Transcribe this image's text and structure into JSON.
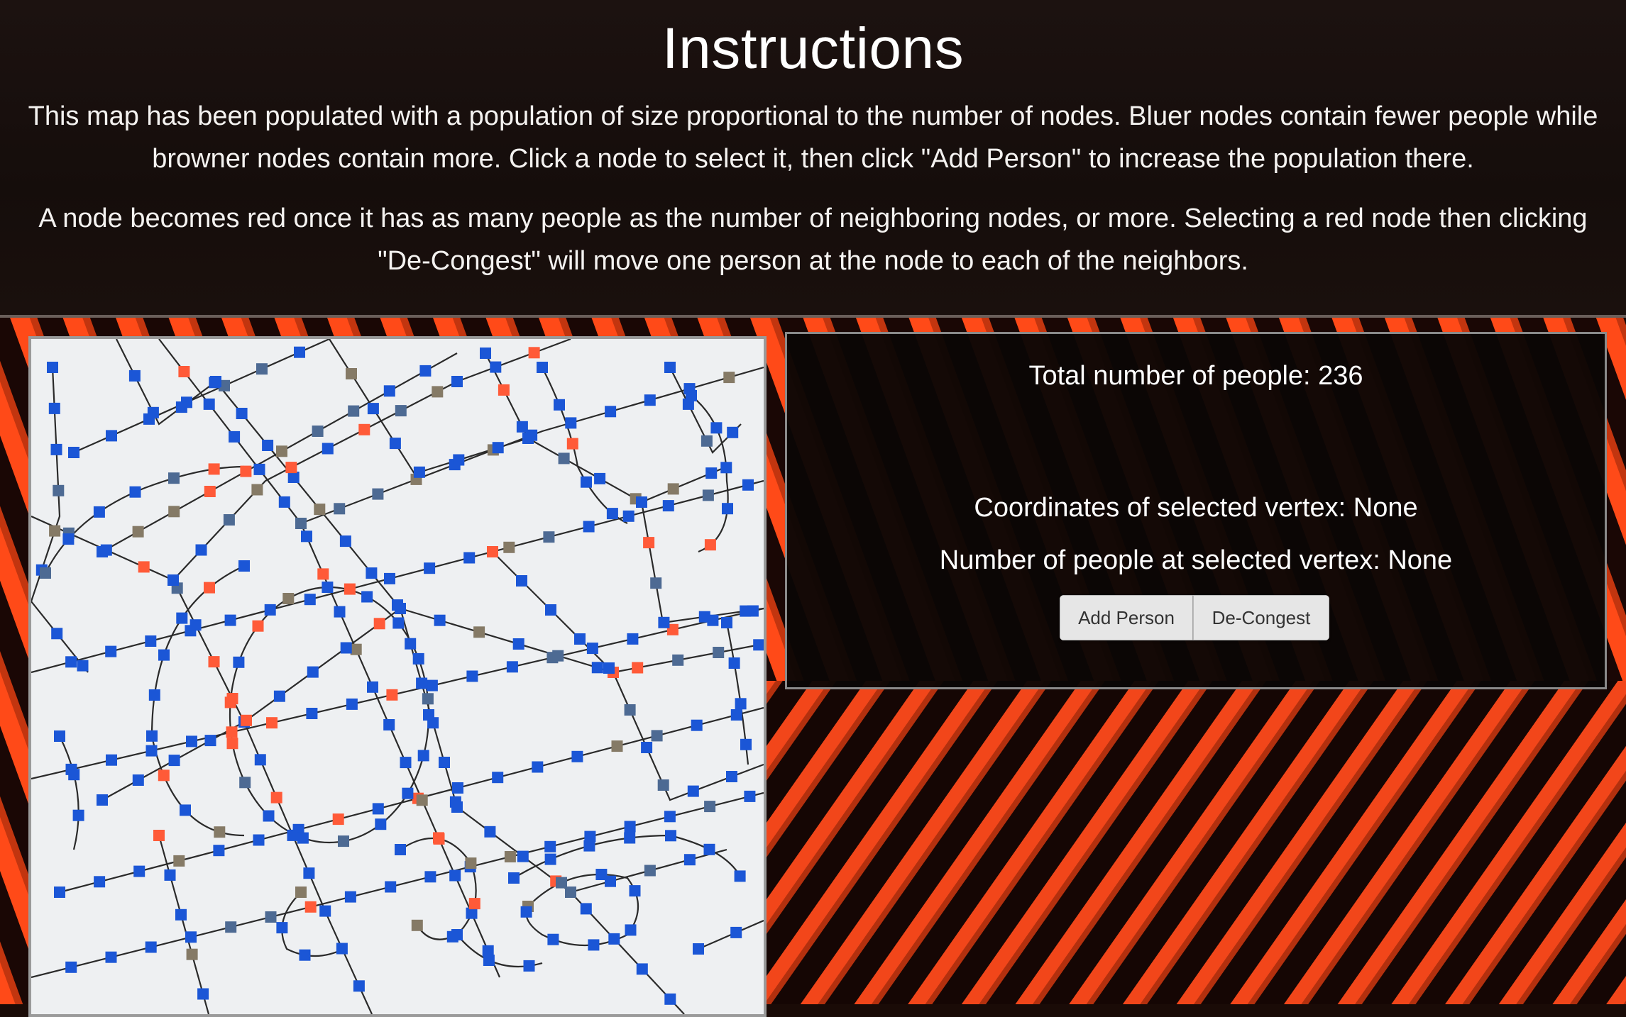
{
  "instructions": {
    "title": "Instructions",
    "paragraph1": "This map has been populated with a population of size proportional to the number of nodes. Bluer nodes contain fewer people while browner nodes contain more. Click a node to select it, then click \"Add Person\" to increase the population there.",
    "paragraph2": "A node becomes red once it has as many people as the number of neighboring nodes, or more. Selecting a red node then clicking \"De-Congest\" will move one person at the node to each of the neighbors."
  },
  "info": {
    "total_label": "Total number of people: 236",
    "coords_label": "Coordinates of selected vertex: None",
    "count_label": "Number of people at selected vertex: None"
  },
  "buttons": {
    "add_person": "Add Person",
    "decongest": "De-Congest"
  },
  "colors": {
    "node_low": "#1b56d6",
    "node_mid": "#4d6a93",
    "node_high": "#857a66",
    "node_congested": "#ff5a38",
    "edge": "#2a2a2a",
    "map_background": "#eef0f2",
    "dune_highlight": "#ff4a18",
    "dune_shadow": "#140604"
  }
}
